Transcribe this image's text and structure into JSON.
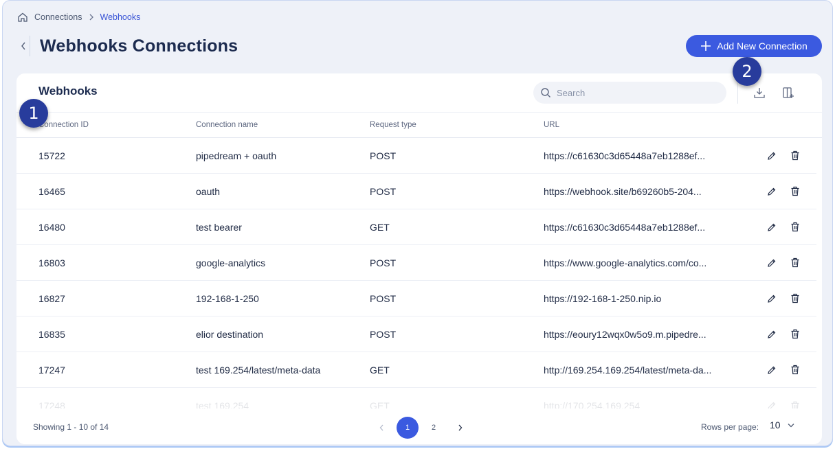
{
  "breadcrumb": {
    "items": [
      "Connections",
      "Webhooks"
    ]
  },
  "page": {
    "title": "Webhooks Connections"
  },
  "header": {
    "add_button_label": "Add New Connection"
  },
  "card": {
    "title": "Webhooks",
    "search": {
      "placeholder": "Search",
      "value": ""
    }
  },
  "table": {
    "columns": [
      "Connection ID",
      "Connection name",
      "Request type",
      "URL"
    ],
    "rows": [
      {
        "id": "15722",
        "name": "pipedream + oauth",
        "type": "POST",
        "url": "https://c61630c3d65448a7eb1288ef..."
      },
      {
        "id": "16465",
        "name": "oauth",
        "type": "POST",
        "url": "https://webhook.site/b69260b5-204..."
      },
      {
        "id": "16480",
        "name": "test bearer",
        "type": "GET",
        "url": "https://c61630c3d65448a7eb1288ef..."
      },
      {
        "id": "16803",
        "name": "google-analytics",
        "type": "POST",
        "url": "https://www.google-analytics.com/co..."
      },
      {
        "id": "16827",
        "name": "192-168-1-250",
        "type": "POST",
        "url": "https://192-168-1-250.nip.io"
      },
      {
        "id": "16835",
        "name": "elior destination",
        "type": "POST",
        "url": "https://eoury12wqx0w5o9.m.pipedre..."
      },
      {
        "id": "17247",
        "name": "test 169.254/latest/meta-data",
        "type": "GET",
        "url": "http://169.254.169.254/latest/meta-da..."
      },
      {
        "id": "17248",
        "name": "test 169.254",
        "type": "GET",
        "url": "http://170.254.169.254"
      }
    ]
  },
  "footer": {
    "showing": "Showing 1 - 10 of 14",
    "pages": [
      "1",
      "2"
    ],
    "current_page": "1",
    "rows_per_page_label": "Rows per page:",
    "rows_per_page_value": "10"
  },
  "markers": [
    "1",
    "2"
  ],
  "colors": {
    "accent": "#3b5ae0",
    "marker": "#283c9c",
    "background": "#eef1f8"
  }
}
